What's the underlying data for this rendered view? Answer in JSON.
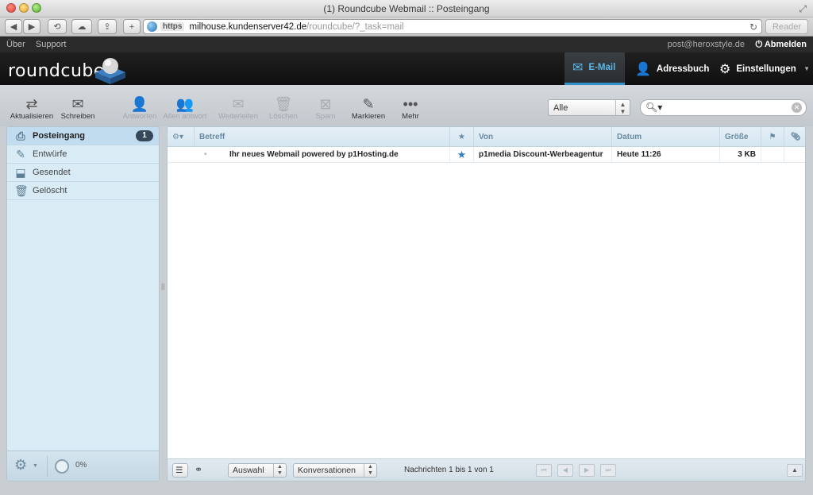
{
  "window": {
    "title": "(1) Roundcube Webmail :: Posteingang"
  },
  "browser": {
    "url_scheme": "https",
    "url_host": "milhouse.kundenserver42.de",
    "url_path": "/roundcube/?_task=mail",
    "reader_label": "Reader"
  },
  "topline": {
    "links": [
      "Über",
      "Support"
    ],
    "user": "post@heroxstyle.de",
    "logout": "Abmelden"
  },
  "header": {
    "logo": "roundcube",
    "nav": [
      {
        "label": "E-Mail",
        "icon": "mail-icon",
        "active": true
      },
      {
        "label": "Adressbuch",
        "icon": "person-icon",
        "active": false
      },
      {
        "label": "Einstellungen",
        "icon": "gear-icon",
        "active": false
      }
    ]
  },
  "toolbar": {
    "refresh": "Aktualisieren",
    "compose": "Schreiben",
    "reply": "Antworten",
    "reply_all": "Allen antwort",
    "forward": "Weiterleiten",
    "delete": "Löschen",
    "spam": "Spam",
    "mark": "Markieren",
    "more": "Mehr"
  },
  "filter": {
    "selected": "Alle"
  },
  "search": {
    "placeholder": ""
  },
  "folders": [
    {
      "label": "Posteingang",
      "icon": "inbox-icon",
      "active": true,
      "unread": "1"
    },
    {
      "label": "Entwürfe",
      "icon": "pencil-icon",
      "active": false,
      "unread": ""
    },
    {
      "label": "Gesendet",
      "icon": "sent-icon",
      "active": false,
      "unread": ""
    },
    {
      "label": "Gelöscht",
      "icon": "trash-icon",
      "active": false,
      "unread": ""
    }
  ],
  "quota": {
    "text": "0%"
  },
  "list": {
    "columns": {
      "subject": "Betreff",
      "from": "Von",
      "date": "Datum",
      "size": "Größe"
    },
    "rows": [
      {
        "subject": "Ihr neues Webmail powered by p1Hosting.de",
        "from": "p1media Discount-Werbeagentur",
        "date": "Heute 11:26",
        "size": "3 KB",
        "flagged": true
      }
    ]
  },
  "footer": {
    "select_label": "Auswahl",
    "threads_label": "Konversationen",
    "count_text": "Nachrichten 1 bis 1 von 1"
  },
  "colors": {
    "accent": "#3090c8",
    "sidebar_bg": "#d9ecf6",
    "unread_badge": "#35495b"
  }
}
